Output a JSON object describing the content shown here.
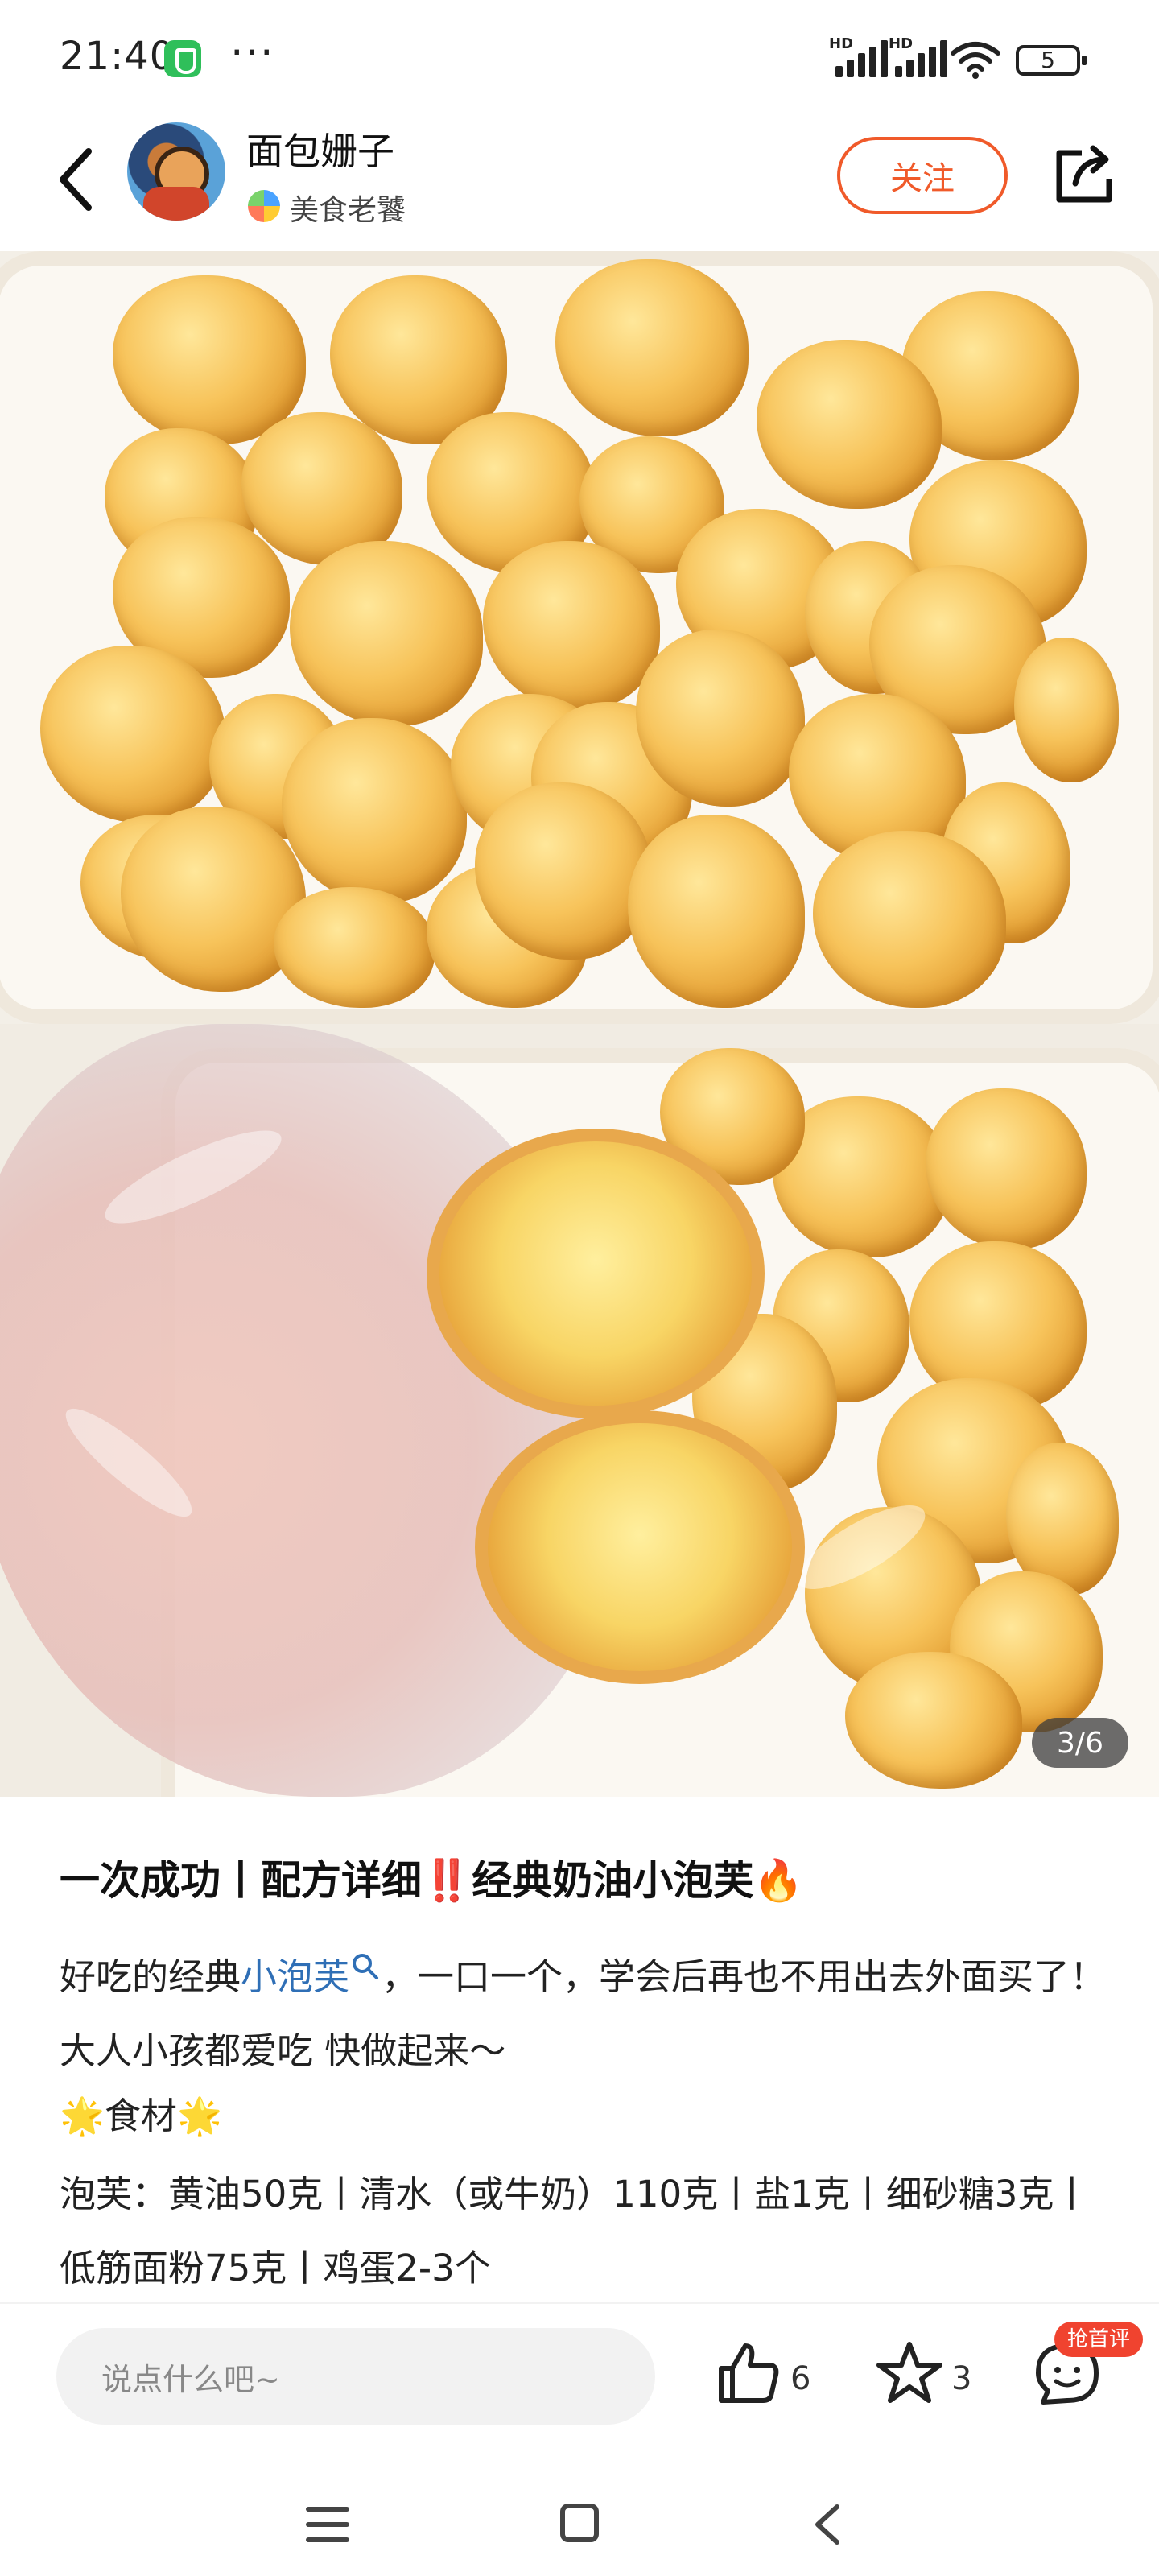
{
  "status_bar": {
    "time": "21:40",
    "signal_label_1": "HD",
    "signal_label_2": "HD",
    "battery": "5",
    "more_icon": "ellipsis-icon",
    "shield_icon": "security-shield-icon"
  },
  "header": {
    "author_name": "面包姗子",
    "author_tag": "美食老饕",
    "follow_label": "关注",
    "back_icon": "chevron-left-icon",
    "share_icon": "share-icon"
  },
  "gallery": {
    "page_indicator": "3/6"
  },
  "post": {
    "title": {
      "part1": "一次成功丨配方详细",
      "mark": "‼️",
      "part2": "经典奶油小泡芙",
      "fire": "🔥"
    },
    "paragraph1": {
      "before": "好吃的经典",
      "tag": "小泡芙",
      "after": "，一口一个，学会后再也不用出去外面买了！大人小孩都爱吃 快做起来～"
    },
    "ingredients_heading": {
      "star": "🌟",
      "text": "食材"
    },
    "paragraph2": "泡芙：黄油50克丨清水（或牛奶）110克丨盐1克丨细砂糖3克丨低筋面粉75克丨鸡蛋2-3个"
  },
  "bottom_bar": {
    "comment_placeholder": "说点什么吧~",
    "like_count": "6",
    "favorite_count": "3",
    "first_comment_badge": "抢首评"
  },
  "colors": {
    "accent": "#f05a2a",
    "link": "#2f6fb6",
    "badge": "#f0432f"
  }
}
